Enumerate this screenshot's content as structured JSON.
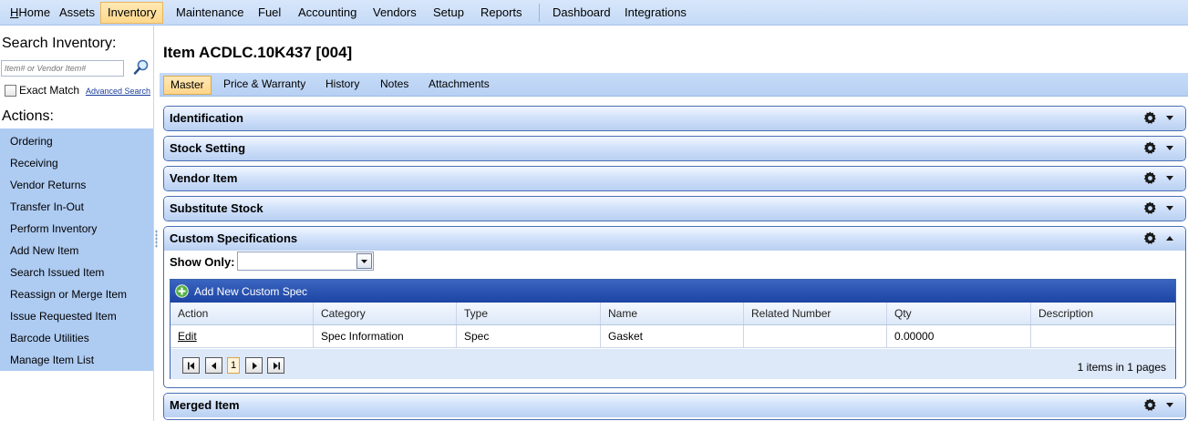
{
  "topnav": {
    "items": [
      "Home",
      "Assets",
      "Inventory",
      "Maintenance",
      "Fuel",
      "Accounting",
      "Vendors",
      "Setup",
      "Reports",
      "Dashboard",
      "Integrations"
    ],
    "active": "Inventory"
  },
  "sidebar": {
    "search_title": "Search Inventory:",
    "search_placeholder": "Item# or Vendor Item#",
    "exact_match": "Exact Match",
    "advanced_search": "Advanced Search",
    "actions_title": "Actions:",
    "actions": [
      "Ordering",
      "Receiving",
      "Vendor Returns",
      "Transfer In-Out",
      "Perform Inventory",
      "Add New Item",
      "Search Issued Item",
      "Reassign or Merge Item",
      "Issue Requested Item",
      "Barcode Utilities",
      "Manage Item List"
    ]
  },
  "page": {
    "title": "Item ACDLC.10K437 [004]"
  },
  "tabs": [
    "Master",
    "Price & Warranty",
    "History",
    "Notes",
    "Attachments"
  ],
  "active_tab": "Master",
  "panels": {
    "identification": "Identification",
    "stock_setting": "Stock Setting",
    "vendor_item": "Vendor Item",
    "substitute_stock": "Substitute Stock",
    "custom_specifications": "Custom Specifications",
    "merged_item": "Merged Item"
  },
  "custom_specs": {
    "show_only_label": "Show Only:",
    "show_only_value": "",
    "add_new": "Add New Custom Spec",
    "columns": [
      "Action",
      "Category",
      "Type",
      "Name",
      "Related Number",
      "Qty",
      "Description"
    ],
    "rows": [
      {
        "action": "Edit",
        "category": "Spec Information",
        "type": "Spec",
        "name": "Gasket",
        "related_number": "",
        "qty": "0.00000",
        "description": ""
      }
    ],
    "pager": {
      "current_page": "1",
      "info": "1 items in 1 pages"
    }
  },
  "colors": {
    "nav_bg": "#c4daf7",
    "active_tab": "#ffd78a",
    "panel_border": "#4a6fb3",
    "grid_toolbar": "#1d44a4",
    "actions_bg": "#aecbf2"
  }
}
